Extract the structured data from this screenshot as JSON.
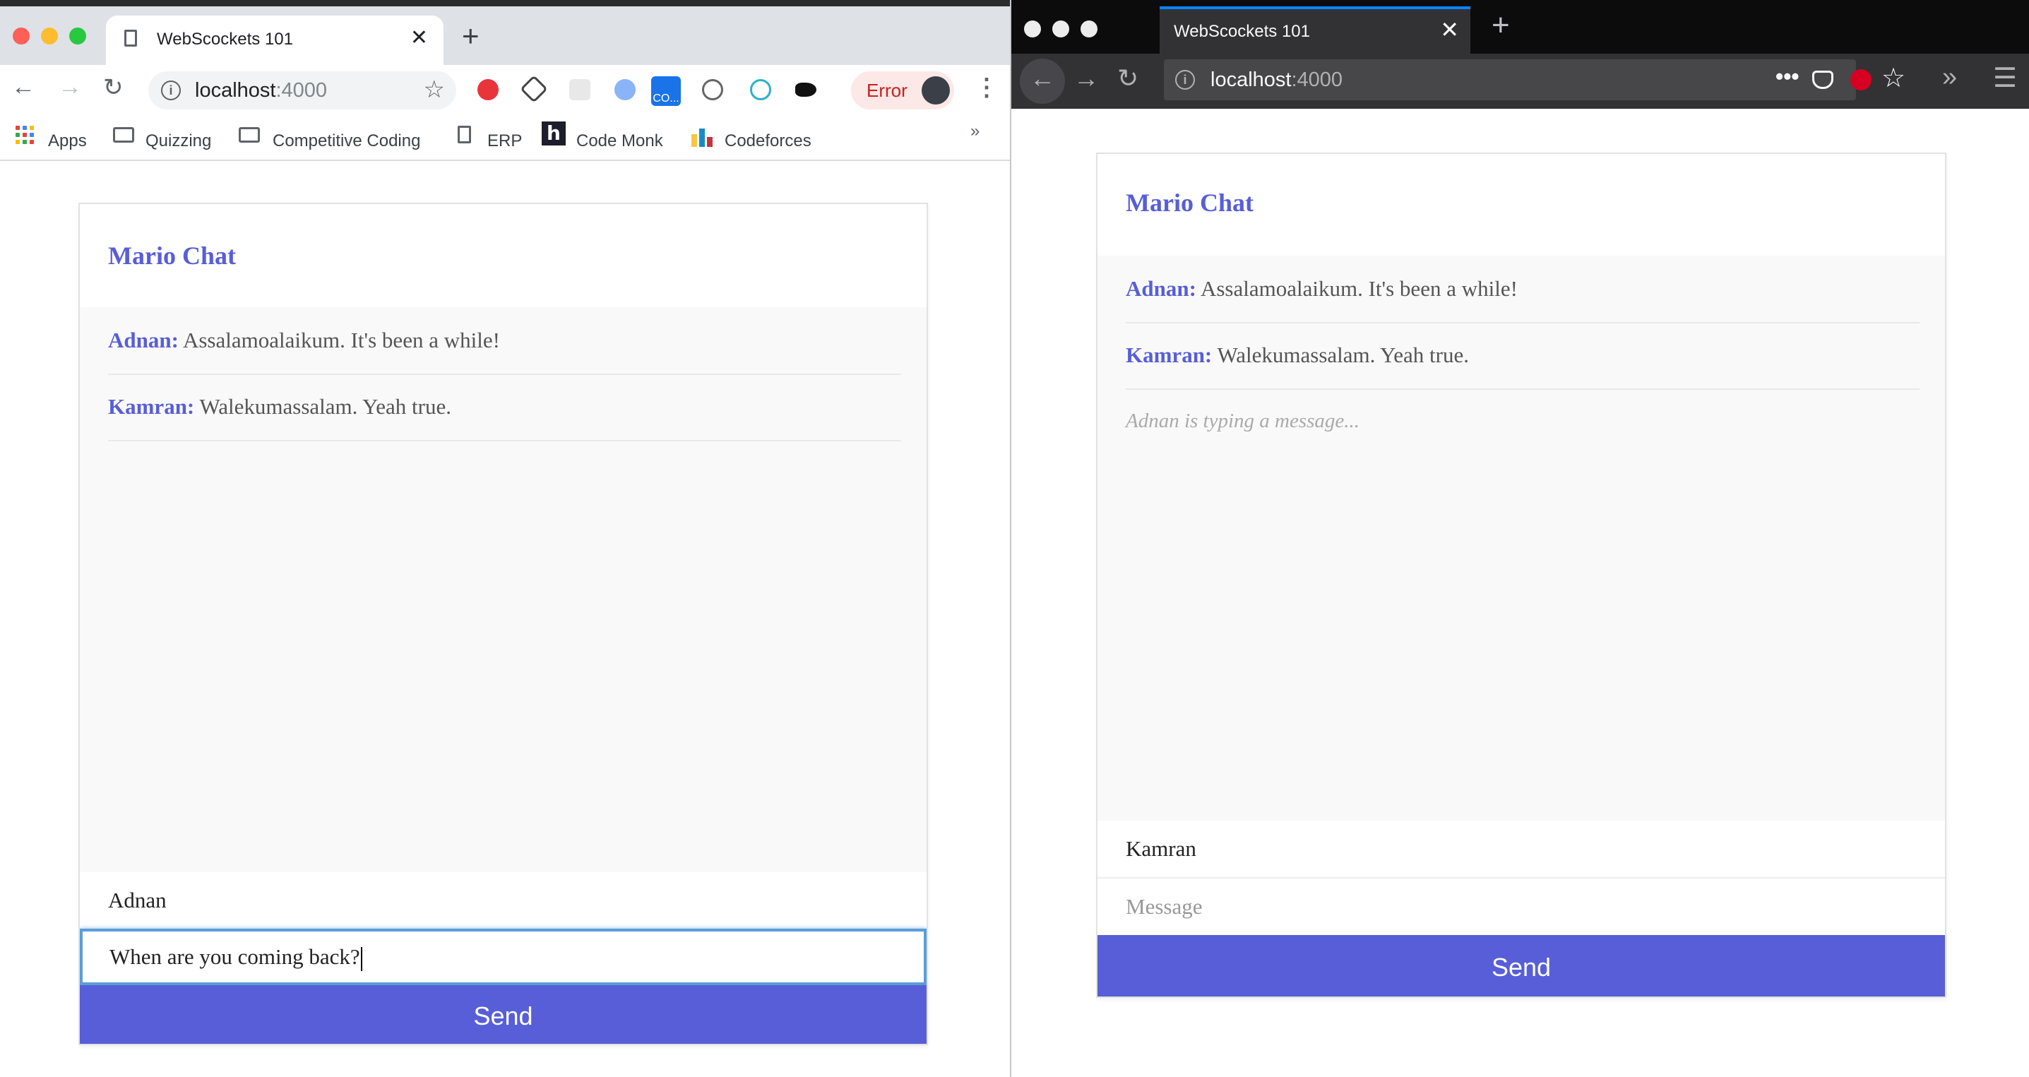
{
  "chrome": {
    "tab_title": "WebScockets 101",
    "url_host": "localhost",
    "url_port": ":4000",
    "error_label": "Error",
    "extension_badge": "CO...",
    "bookmarks_more": "»",
    "bookmarks": [
      {
        "label": "Apps",
        "icon": "apps-grid-icon"
      },
      {
        "label": "Quizzing",
        "icon": "folder-icon"
      },
      {
        "label": "Competitive Coding",
        "icon": "folder-icon"
      },
      {
        "label": "ERP",
        "icon": "document-icon"
      },
      {
        "label": "Code Monk",
        "icon": "hackerearth-icon"
      },
      {
        "label": "Codeforces",
        "icon": "codeforces-icon"
      }
    ]
  },
  "firefox": {
    "tab_title": "WebScockets 101",
    "url_host": "localhost",
    "url_port": ":4000"
  },
  "left_chat": {
    "title": "Mario Chat",
    "messages": [
      {
        "sender": "Adnan:",
        "text": "Assalamoalaikum. It's been a while!"
      },
      {
        "sender": "Kamran:",
        "text": "Walekumassalam. Yeah true."
      }
    ],
    "handle_value": "Adnan",
    "message_value": "When are you coming back?",
    "send_label": "Send"
  },
  "right_chat": {
    "title": "Mario Chat",
    "messages": [
      {
        "sender": "Adnan:",
        "text": "Assalamoalaikum. It's been a while!"
      },
      {
        "sender": "Kamran:",
        "text": "Walekumassalam. Yeah true."
      }
    ],
    "feedback": "Adnan is typing a message...",
    "handle_value": "Kamran",
    "message_placeholder": "Message",
    "send_label": "Send"
  },
  "colors": {
    "accent": "#575ed8",
    "chrome_tabbar": "#dee1e6",
    "firefox_toolbar": "#323234",
    "firefox_tab_highlight": "#0a84ff",
    "error_text": "#c5221f"
  }
}
